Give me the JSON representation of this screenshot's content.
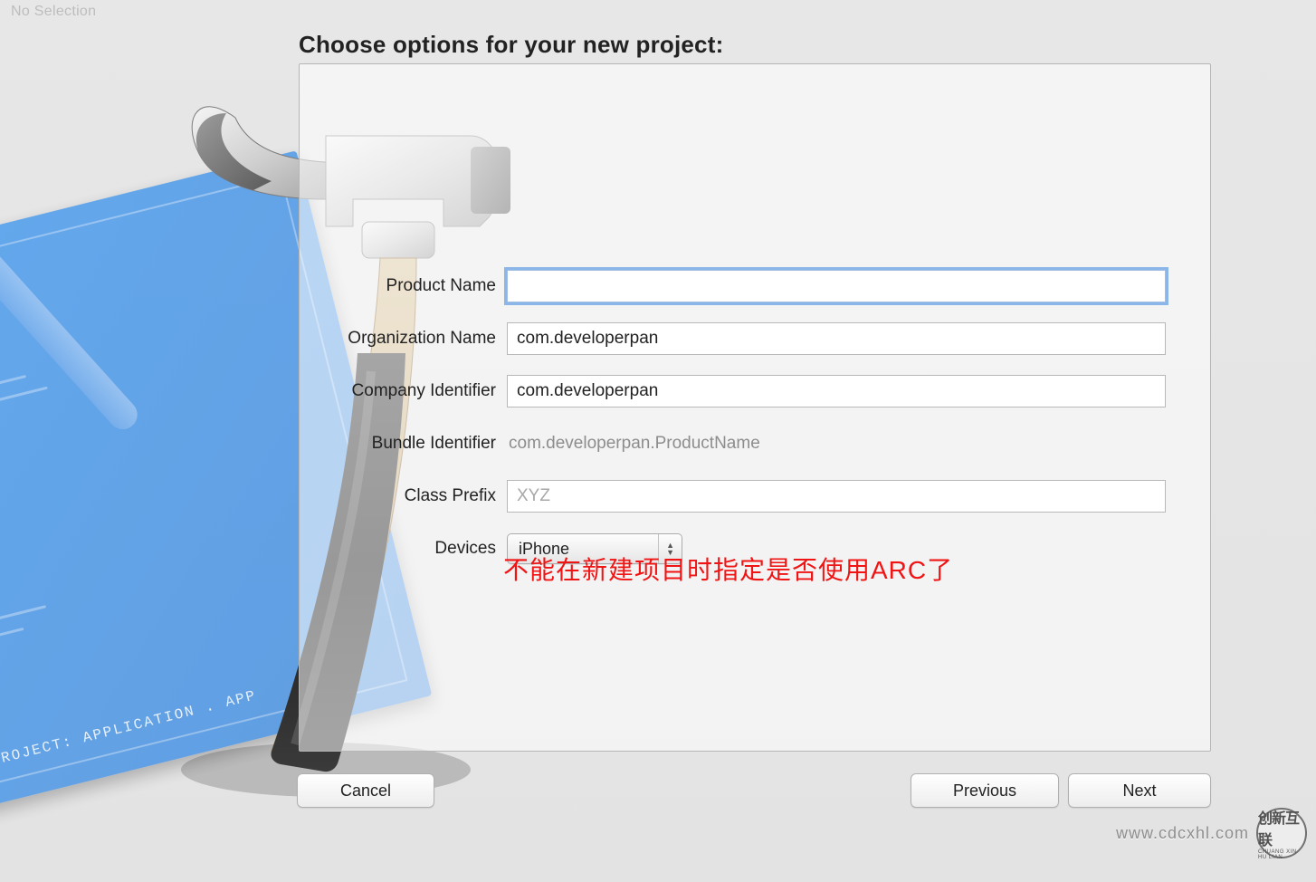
{
  "titlebar": "No Selection",
  "heading": "Choose options for your new project:",
  "form": {
    "product_name": {
      "label": "Product Name",
      "value": ""
    },
    "org_name": {
      "label": "Organization Name",
      "value": "com.developerpan"
    },
    "company_id": {
      "label": "Company Identifier",
      "value": "com.developerpan"
    },
    "bundle_id": {
      "label": "Bundle Identifier",
      "value": "com.developerpan.ProductName"
    },
    "class_prefix": {
      "label": "Class Prefix",
      "value": "",
      "placeholder": "XYZ"
    },
    "devices": {
      "label": "Devices",
      "value": "iPhone"
    }
  },
  "annotation": "不能在新建项目时指定是否使用ARC了",
  "buttons": {
    "cancel": "Cancel",
    "previous": "Previous",
    "next": "Next"
  },
  "blueprint": {
    "project_line": "PROJECT: APPLICATION . APP"
  },
  "watermark": {
    "url": "www.cdcxhl.com",
    "logo_big": "创新互联",
    "logo_small": "CHUANG XIN HU LIAN"
  }
}
